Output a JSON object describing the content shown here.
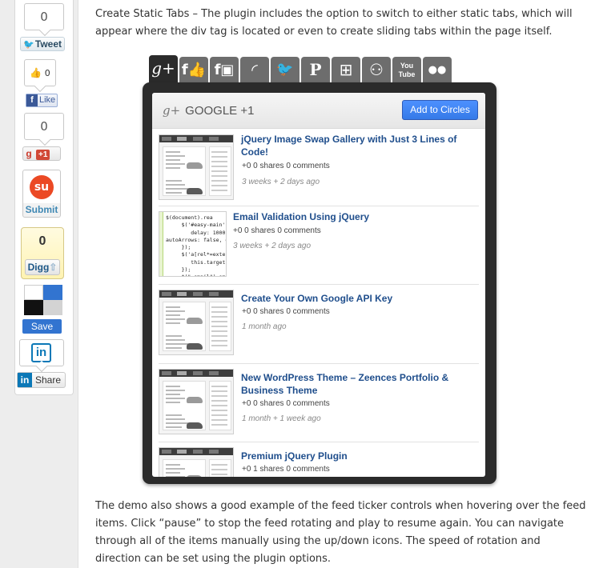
{
  "share_bar": {
    "tweet_count": "0",
    "tweet_label": "Tweet",
    "fb_count": "0",
    "fb_like_label": "Like",
    "gplus_count": "0",
    "gplus_label": "+1",
    "stumble_label": "Submit",
    "digg_count": "0",
    "digg_label": "Digg",
    "delicious_label": "Save",
    "linkedin_label": "Share"
  },
  "article": {
    "para_top": "Create Static Tabs – The plugin includes the option to switch to either static tabs, which will appear where the div tag is located or even to create sliding tabs within the page itself.",
    "para_bottom": "The demo also shows a good example of the feed ticker controls when hovering over the feed items. Click “pause” to stop the feed rotating and play to resume again. You can navigate through all of the items manually using the up/down icons. The speed of rotation and direction can be set using the plugin options."
  },
  "widget": {
    "tabs": [
      {
        "name": "google-plus",
        "glyph": "g+"
      },
      {
        "name": "facebook-like",
        "glyph": "f👍"
      },
      {
        "name": "facebook",
        "glyph": "f▣"
      },
      {
        "name": "rss",
        "glyph": "◜"
      },
      {
        "name": "twitter",
        "glyph": "🐦"
      },
      {
        "name": "pinterest",
        "glyph": "P"
      },
      {
        "name": "windows",
        "glyph": "⊞"
      },
      {
        "name": "delicious-people",
        "glyph": "⚇"
      },
      {
        "name": "youtube",
        "glyph": "You Tube"
      },
      {
        "name": "flickr",
        "glyph": "●●"
      }
    ],
    "title_icon": "g+",
    "title": "GOOGLE +1",
    "add_button": "Add to Circles",
    "items": [
      {
        "title_line1": "jQuery Image Swap Gallery with Just 3 Lines of",
        "title_line2": "Code!",
        "stats": "+0   0 shares   0 comments",
        "age": "3 weeks + 2 days ago",
        "thumb": "site"
      },
      {
        "title_line1": "Email Validation Using jQuery",
        "title_line2": "",
        "stats": "+0   0 shares   0 comments",
        "age": "3 weeks + 2 days ago",
        "thumb": "code"
      },
      {
        "title_line1": "Create Your Own Google API Key",
        "title_line2": "",
        "stats": "+0   0 shares   0 comments",
        "age": "1 month ago",
        "thumb": "site"
      },
      {
        "title_line1": "New WordPress Theme – Zeences Portfolio &",
        "title_line2": "Business Theme",
        "stats": "+0   0 shares   0 comments",
        "age": "1 month + 1 week ago",
        "thumb": "site"
      },
      {
        "title_line1": "Premium jQuery Plugin",
        "title_line2": "",
        "stats": "+0   1 shares   0 comments",
        "age": "",
        "thumb": "site"
      }
    ]
  }
}
